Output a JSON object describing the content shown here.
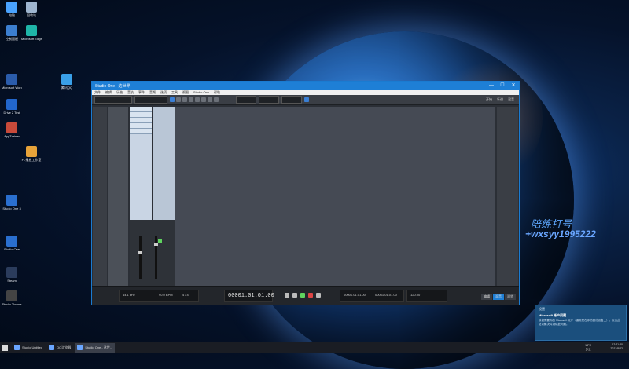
{
  "desktop_icons": [
    {
      "label": "电脑",
      "color": "#4aa3ff"
    },
    {
      "label": "回收站",
      "color": "#9fb6d0"
    },
    {
      "label": "控制面板",
      "color": "#3c7fd0"
    },
    {
      "label": "Microsoft Edge",
      "color": "#1fb5a8"
    },
    {
      "label": "Microsoft Word 2010",
      "color": "#2b5cab"
    },
    {
      "label": "Drive 2 Test",
      "color": "#2266cc"
    },
    {
      "label": "AppTrainer",
      "color": "#c84a3a"
    },
    {
      "label": "FL播放工作室",
      "color": "#e7a33a"
    },
    {
      "label": "腾讯QQ",
      "color": "#3aa0e8"
    },
    {
      "label": "Studio One 3",
      "color": "#2a6fcf"
    },
    {
      "label": "Steam",
      "color": "#2b3c5c"
    },
    {
      "label": "Studio Throne",
      "color": "#444"
    },
    {
      "label": "Studio One",
      "color": "#2a6fcf"
    }
  ],
  "window": {
    "title": "Studio One - 这世界",
    "min": "—",
    "max": "☐",
    "close": "✕",
    "menu": [
      "文件",
      "编辑",
      "乐曲",
      "音轨",
      "事件",
      "音频",
      "选项",
      "工具",
      "视图",
      "Studio One",
      "帮助"
    ],
    "toolbar_labels": [
      "开始",
      "乐谱",
      "混音"
    ],
    "transport": {
      "time": "00001.01.01.00",
      "bpm": "90.0 BPM",
      "signature": "4 / 4",
      "left_info": "44.1 kHz",
      "right_pos": "00001.01.01.00",
      "end_pos": "00061.01.01.00",
      "tempo_label": "120.00"
    },
    "right_tabs": [
      "编辑",
      "混音",
      "浏览"
    ]
  },
  "watermark": {
    "line1": "陪练打号",
    "line2": "+wxsyy1995222"
  },
  "notification": {
    "header": "设置",
    "title": "Microsoft 帐户问题",
    "body": "我们需要你的 Microsoft 帐户（通常是在你的其他设备上）。点击此处以解决并消除此问题。"
  },
  "taskbar": {
    "items": [
      {
        "label": "Studio Untitled",
        "active": false
      },
      {
        "label": "QQ浏览器",
        "active": false
      },
      {
        "label": "Studio One - 这世...",
        "active": true
      }
    ],
    "weather": "18°C\n多云",
    "time": "12:21:40",
    "date": "2021/8/22"
  }
}
